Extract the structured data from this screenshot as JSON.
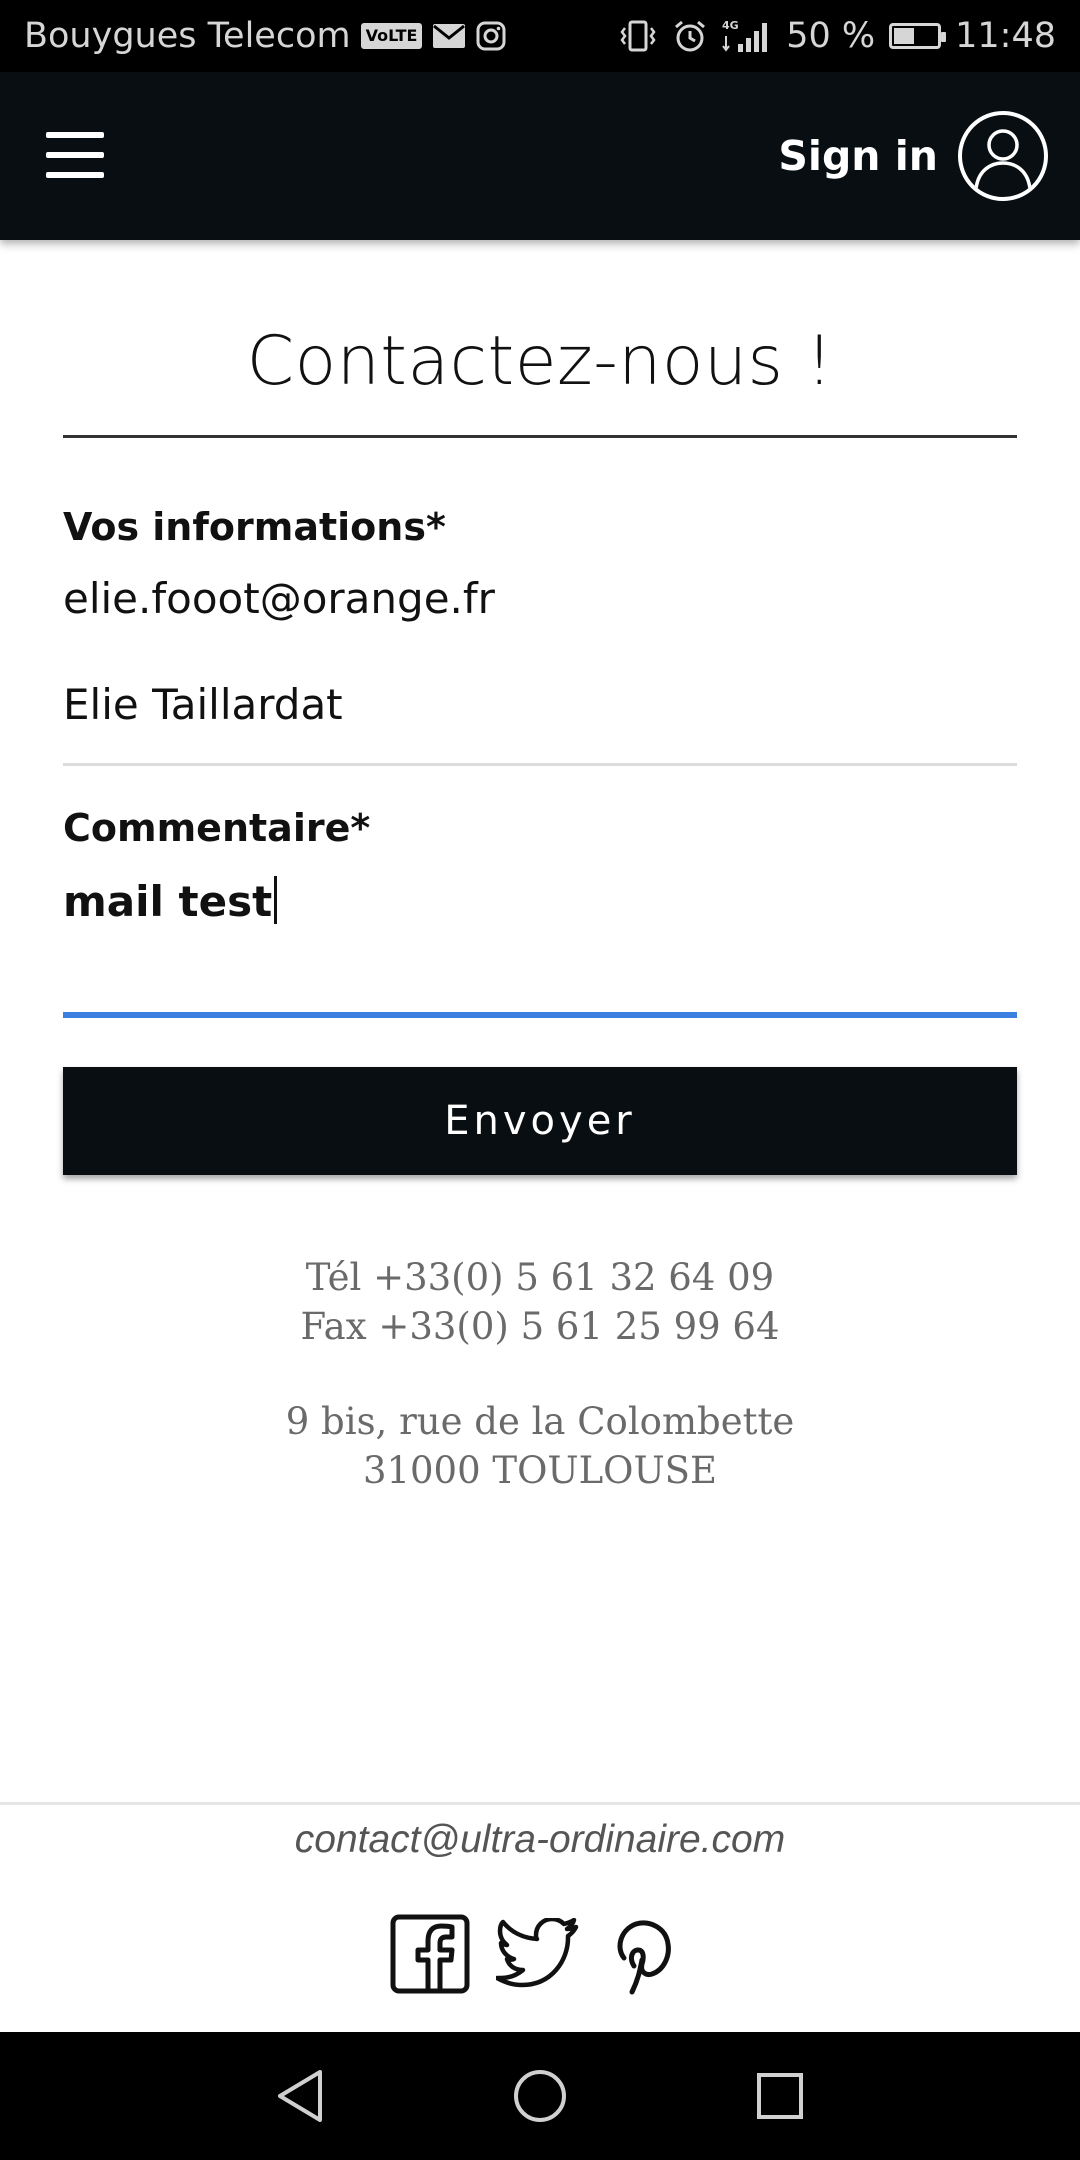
{
  "status_bar": {
    "carrier": "Bouygues Telecom",
    "volte": "VoLTE",
    "network": "4G",
    "battery_percent_label": "50 %",
    "battery_level": 0.5,
    "time": "11:48",
    "icons": [
      "mail-icon",
      "instagram-icon",
      "vibrate-icon",
      "alarm-icon",
      "signal-icon",
      "battery-icon"
    ]
  },
  "header": {
    "menu_icon": "hamburger-menu-icon",
    "sign_in_label": "Sign in",
    "avatar_icon": "user-avatar-icon",
    "background": "#080e11"
  },
  "page": {
    "title": "Contactez-nous !"
  },
  "form": {
    "info_label": "Vos informations*",
    "email_value": "elie.fooot@orange.fr",
    "name_value": "Elie Taillardat",
    "comment_label": "Commentaire*",
    "comment_value": "mail test",
    "submit_label": "Envoyer",
    "accent_color": "#3d7fe0"
  },
  "contact": {
    "phone": "Tél +33(0) 5 61 32 64 09",
    "fax": "Fax +33(0) 5 61 25 99 64",
    "address_line1": "9 bis, rue de la Colombette",
    "address_line2": "31000 TOULOUSE"
  },
  "footer": {
    "email": "contact@ultra-ordinaire.com",
    "social_icons": [
      "facebook-icon",
      "twitter-icon",
      "pinterest-icon"
    ]
  },
  "navigation_bar": {
    "icons": [
      "back-icon",
      "home-icon",
      "recents-icon"
    ]
  }
}
